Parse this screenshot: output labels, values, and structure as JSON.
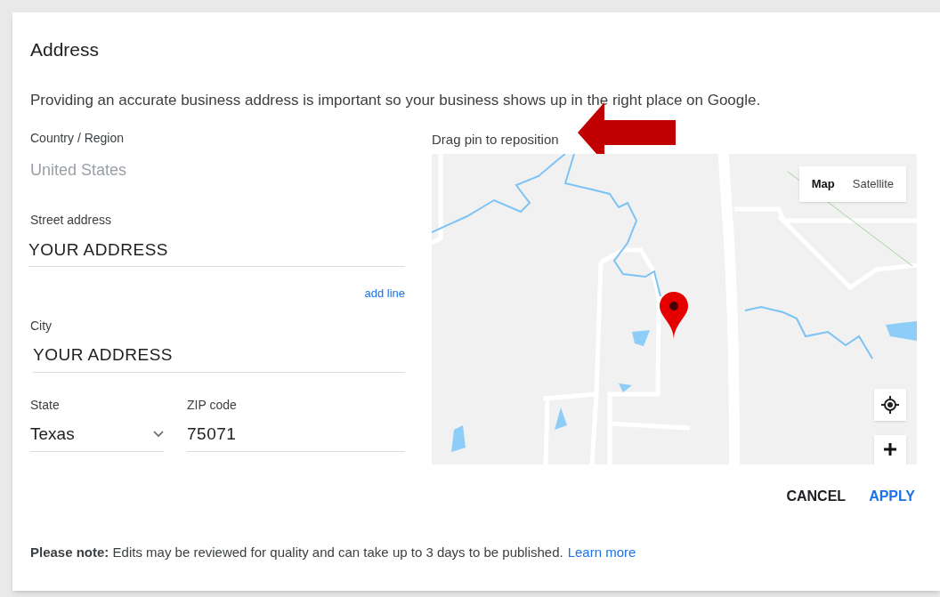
{
  "dialog": {
    "title": "Address",
    "description": "Providing an accurate business address is important so your business shows up in the right place on Google."
  },
  "country": {
    "label": "Country / Region",
    "value": "United States",
    "disabled": true
  },
  "street": {
    "label": "Street address",
    "value": "YOUR ADDRESS"
  },
  "add_line": "add line",
  "city": {
    "label": "City",
    "value": "YOUR ADDRESS"
  },
  "state": {
    "label": "State",
    "value": "Texas"
  },
  "zip": {
    "label": "ZIP code",
    "value": "75071"
  },
  "map": {
    "hint": "Drag pin to reposition",
    "map_types": [
      {
        "label": "Map",
        "selected": true
      },
      {
        "label": "Satellite",
        "selected": false
      }
    ]
  },
  "buttons": [
    {
      "label": "CANCEL",
      "kind": "secondary"
    },
    {
      "label": "APPLY",
      "kind": "primary"
    }
  ],
  "note": {
    "text": "**Please note:** Edits may be reviewed for quality and can take up to 3 days to be published.",
    "link": "Learn more"
  }
}
